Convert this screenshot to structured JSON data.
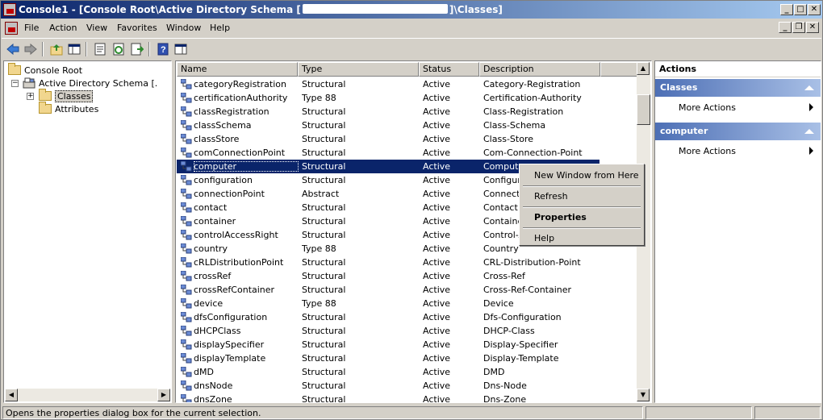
{
  "window": {
    "title_prefix": "Console1 - [Console Root\\Active Directory Schema [",
    "title_suffix": "]\\Classes]"
  },
  "menu": [
    "File",
    "Action",
    "View",
    "Favorites",
    "Window",
    "Help"
  ],
  "tree": {
    "root": "Console Root",
    "schema": "Active Directory Schema [.",
    "classes": "Classes",
    "attributes": "Attributes"
  },
  "columns": [
    "Name",
    "Type",
    "Status",
    "Description"
  ],
  "rows": [
    {
      "name": "categoryRegistration",
      "type": "Structural",
      "status": "Active",
      "description": "Category-Registration"
    },
    {
      "name": "certificationAuthority",
      "type": "Type 88",
      "status": "Active",
      "description": "Certification-Authority"
    },
    {
      "name": "classRegistration",
      "type": "Structural",
      "status": "Active",
      "description": "Class-Registration"
    },
    {
      "name": "classSchema",
      "type": "Structural",
      "status": "Active",
      "description": "Class-Schema"
    },
    {
      "name": "classStore",
      "type": "Structural",
      "status": "Active",
      "description": "Class-Store"
    },
    {
      "name": "comConnectionPoint",
      "type": "Structural",
      "status": "Active",
      "description": "Com-Connection-Point"
    },
    {
      "name": "computer",
      "type": "Structural",
      "status": "Active",
      "description": "Compute",
      "selected": true
    },
    {
      "name": "configuration",
      "type": "Structural",
      "status": "Active",
      "description": "Configura"
    },
    {
      "name": "connectionPoint",
      "type": "Abstract",
      "status": "Active",
      "description": "Connectio"
    },
    {
      "name": "contact",
      "type": "Structural",
      "status": "Active",
      "description": "Contact"
    },
    {
      "name": "container",
      "type": "Structural",
      "status": "Active",
      "description": "Containe"
    },
    {
      "name": "controlAccessRight",
      "type": "Structural",
      "status": "Active",
      "description": "Control-A"
    },
    {
      "name": "country",
      "type": "Type 88",
      "status": "Active",
      "description": "Country"
    },
    {
      "name": "cRLDistributionPoint",
      "type": "Structural",
      "status": "Active",
      "description": "CRL-Distribution-Point"
    },
    {
      "name": "crossRef",
      "type": "Structural",
      "status": "Active",
      "description": "Cross-Ref"
    },
    {
      "name": "crossRefContainer",
      "type": "Structural",
      "status": "Active",
      "description": "Cross-Ref-Container"
    },
    {
      "name": "device",
      "type": "Type 88",
      "status": "Active",
      "description": "Device"
    },
    {
      "name": "dfsConfiguration",
      "type": "Structural",
      "status": "Active",
      "description": "Dfs-Configuration"
    },
    {
      "name": "dHCPClass",
      "type": "Structural",
      "status": "Active",
      "description": "DHCP-Class"
    },
    {
      "name": "displaySpecifier",
      "type": "Structural",
      "status": "Active",
      "description": "Display-Specifier"
    },
    {
      "name": "displayTemplate",
      "type": "Structural",
      "status": "Active",
      "description": "Display-Template"
    },
    {
      "name": "dMD",
      "type": "Structural",
      "status": "Active",
      "description": "DMD"
    },
    {
      "name": "dnsNode",
      "type": "Structural",
      "status": "Active",
      "description": "Dns-Node"
    },
    {
      "name": "dnsZone",
      "type": "Structural",
      "status": "Active",
      "description": "Dns-Zone"
    }
  ],
  "actions": {
    "title": "Actions",
    "sections": [
      {
        "header": "Classes",
        "item": "More Actions"
      },
      {
        "header": "computer",
        "item": "More Actions"
      }
    ]
  },
  "context_menu": [
    "New Window from Here",
    "Refresh",
    "Properties",
    "Help"
  ],
  "status_text": "Opens the properties dialog box for the current selection.",
  "colors": {
    "selection": "#0a246a",
    "titlebar": "#0a246a",
    "action_header": "#4d6fb5"
  }
}
